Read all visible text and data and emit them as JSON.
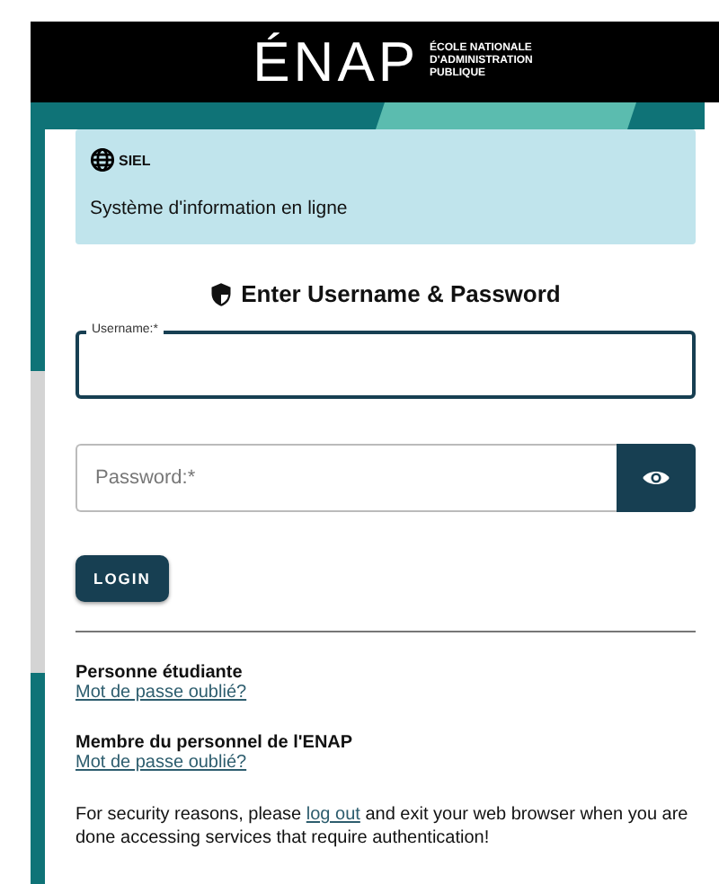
{
  "header": {
    "logo": "ÉNAP",
    "logo_lines": [
      "ÉCOLE NATIONALE",
      "D'ADMINISTRATION",
      "PUBLIQUE"
    ]
  },
  "info": {
    "app": "SIEL",
    "description": "Système d'information en ligne"
  },
  "form": {
    "heading": "Enter Username & Password",
    "username": {
      "label": "Username:*",
      "focused": true
    },
    "password": {
      "placeholder": "Password:*"
    },
    "login": "LOGIN"
  },
  "links": [
    {
      "title": "Personne étudiante",
      "link": "Mot de passe oublié?"
    },
    {
      "title": "Membre du personnel de l'ENAP",
      "link": "Mot de passe oublié?"
    }
  ],
  "notice": {
    "before": "For security reasons, please ",
    "link": "log out",
    "after": " and exit your web browser when you are done accessing services that require authentication!"
  }
}
